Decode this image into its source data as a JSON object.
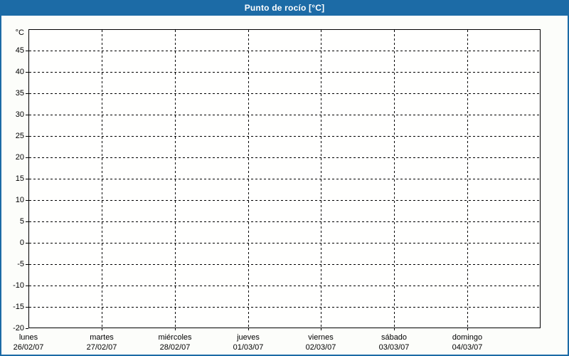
{
  "window": {
    "title": "Punto de rocío [°C]"
  },
  "colors": {
    "titlebar_bg": "#1c6ba6",
    "titlebar_text": "#ffffff",
    "window_border": "#1c6ba6",
    "window_bg": "#fcfdfa",
    "plot_bg": "#fffffe",
    "grid": "#000000",
    "axis": "#000000",
    "label_text": "#000000"
  },
  "chart_data": {
    "type": "line",
    "title": "Punto de rocío [°C]",
    "y_unit_label": "°C",
    "ylim": [
      -20,
      50
    ],
    "ytick_step": 5,
    "ygrid_values": [
      45,
      40,
      35,
      30,
      25,
      20,
      15,
      10,
      5,
      0,
      -5,
      -10,
      -15
    ],
    "y_min_label": "-20",
    "categories": [
      {
        "day": "lunes",
        "date": "26/02/07"
      },
      {
        "day": "martes",
        "date": "27/02/07"
      },
      {
        "day": "miércoles",
        "date": "28/02/07"
      },
      {
        "day": "jueves",
        "date": "01/03/07"
      },
      {
        "day": "viernes",
        "date": "02/03/07"
      },
      {
        "day": "sábado",
        "date": "03/03/07"
      },
      {
        "day": "domingo",
        "date": "04/03/07"
      }
    ],
    "x_intervals": 7,
    "grid": "dashed",
    "legend": "none",
    "series": [],
    "note": "empty plot - no data series drawn"
  }
}
